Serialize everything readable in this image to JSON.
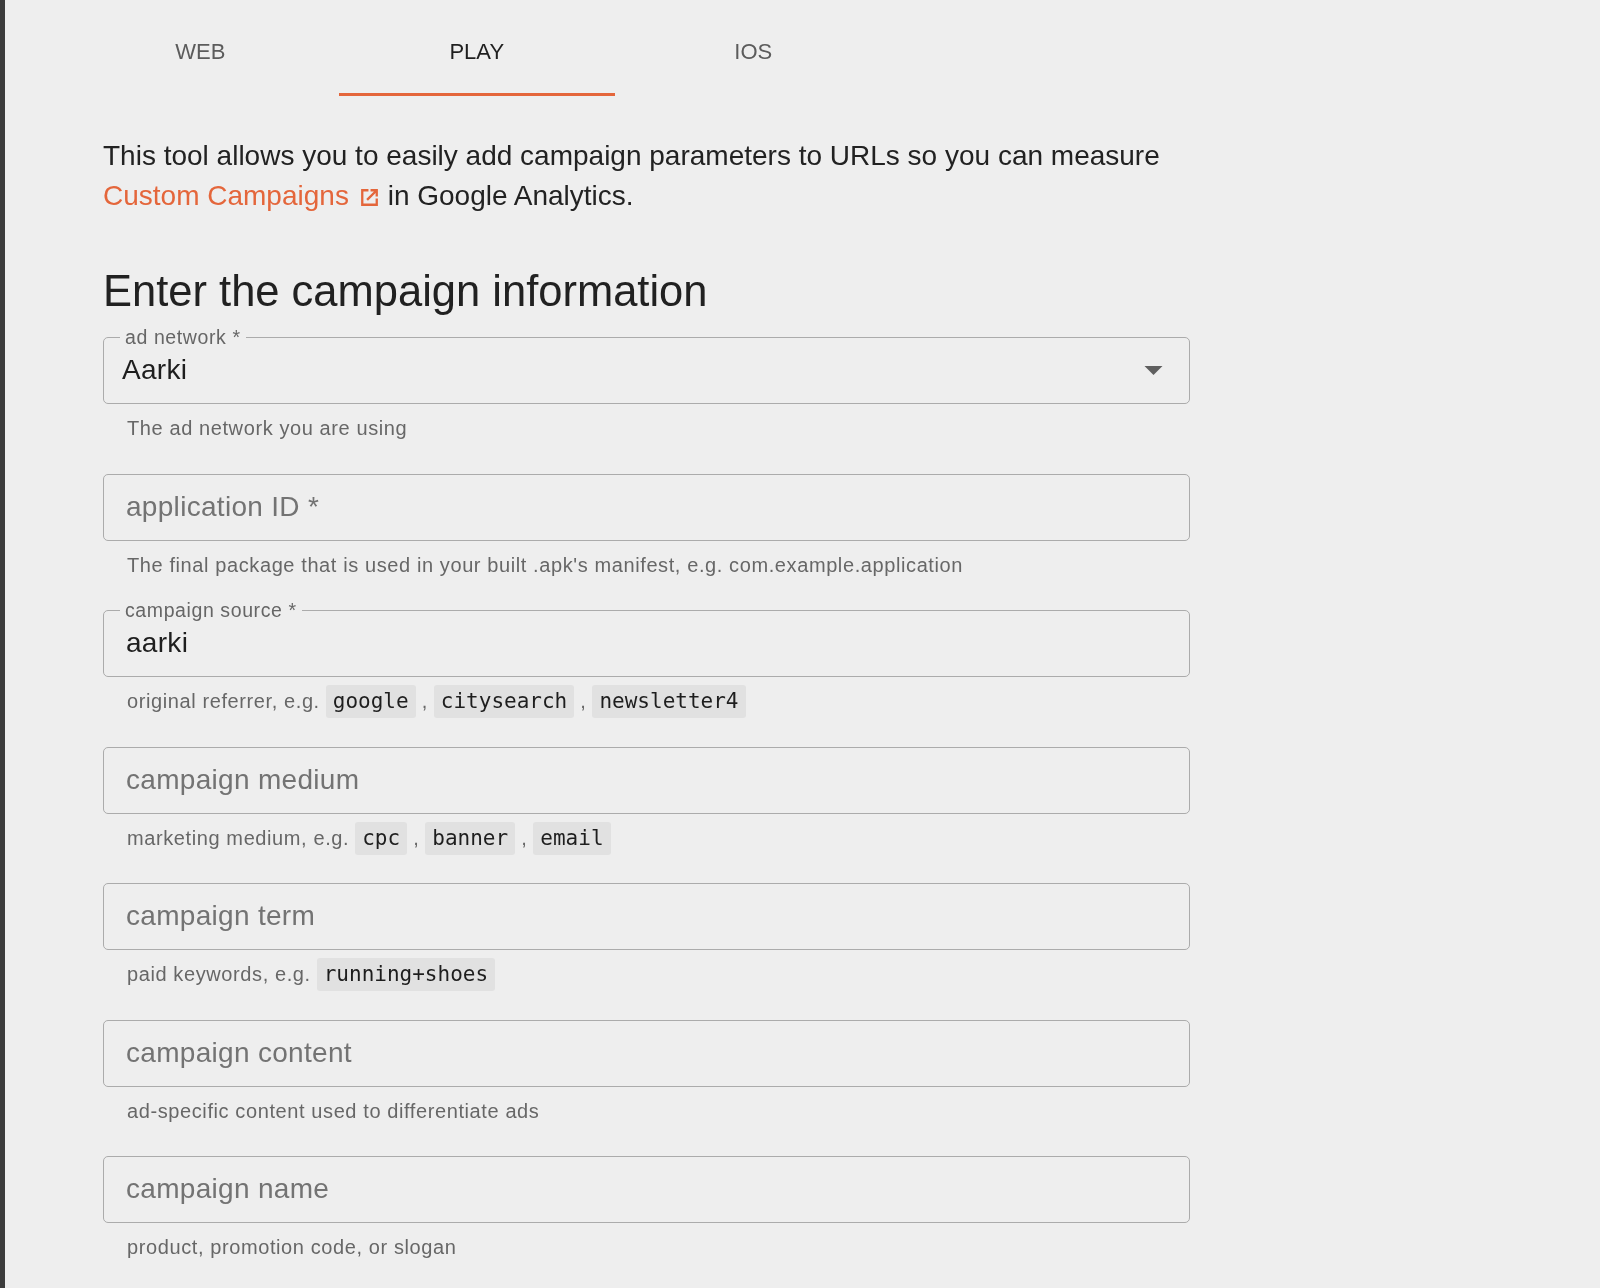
{
  "tabs": [
    {
      "label": "WEB",
      "selected": false
    },
    {
      "label": "PLAY",
      "selected": true
    },
    {
      "label": "IOS",
      "selected": false
    }
  ],
  "intro": {
    "text": "This tool allows you to easily add campaign parameters to URLs so you can measure",
    "link": "Custom Campaigns",
    "text_after": "in Google Analytics."
  },
  "heading": "Enter the campaign information",
  "fields": [
    {
      "kind": "select",
      "label": "ad network *",
      "value": "Aarki",
      "helper": [
        {
          "kind": "text",
          "text": "The ad network you are using"
        }
      ]
    },
    {
      "kind": "text",
      "placeholder": "application ID *",
      "helper": [
        {
          "kind": "text",
          "text": "The final package that is used in your built .apk's manifest, e.g. com.example.application"
        }
      ]
    },
    {
      "kind": "text",
      "label": "campaign source *",
      "value": "aarki",
      "helper": [
        {
          "kind": "text",
          "text": "original referrer, e.g."
        },
        {
          "kind": "code",
          "text": "google"
        },
        {
          "kind": "text",
          "text": ","
        },
        {
          "kind": "code",
          "text": "citysearch"
        },
        {
          "kind": "text",
          "text": ","
        },
        {
          "kind": "code",
          "text": "newsletter4"
        }
      ]
    },
    {
      "kind": "text",
      "placeholder": "campaign medium",
      "helper": [
        {
          "kind": "text",
          "text": "marketing medium, e.g."
        },
        {
          "kind": "code",
          "text": "cpc"
        },
        {
          "kind": "text",
          "text": ","
        },
        {
          "kind": "code",
          "text": "banner"
        },
        {
          "kind": "text",
          "text": ","
        },
        {
          "kind": "code",
          "text": "email"
        }
      ]
    },
    {
      "kind": "text",
      "placeholder": "campaign term",
      "helper": [
        {
          "kind": "text",
          "text": "paid keywords, e.g."
        },
        {
          "kind": "code",
          "text": "running+shoes"
        }
      ]
    },
    {
      "kind": "text",
      "placeholder": "campaign content",
      "helper": [
        {
          "kind": "text",
          "text": "ad-specific content used to differentiate ads"
        }
      ]
    },
    {
      "kind": "text",
      "placeholder": "campaign name",
      "helper": [
        {
          "kind": "text",
          "text": "product, promotion code, or slogan"
        }
      ]
    }
  ]
}
